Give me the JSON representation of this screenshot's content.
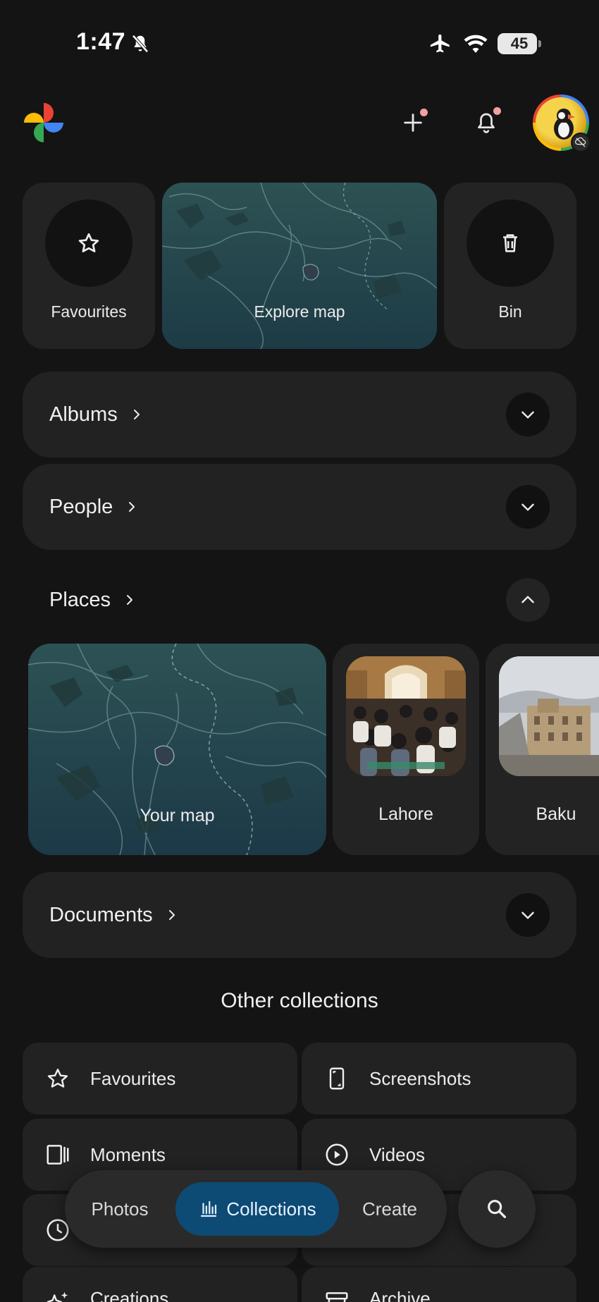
{
  "status_bar": {
    "time": "1:47",
    "battery_level": "45"
  },
  "header": {
    "logo": "google-photos-pinwheel-icon",
    "add_icon": "plus-icon",
    "notifications_icon": "bell-icon",
    "accent_dot_color": "#f2a0a0"
  },
  "quick_tiles": {
    "favourites_label": "Favourites",
    "map_label": "Explore map",
    "bin_label": "Bin"
  },
  "sections": {
    "albums": "Albums",
    "people": "People",
    "places": "Places",
    "documents": "Documents"
  },
  "places": {
    "map_label": "Your map",
    "items": [
      {
        "label": "Lahore"
      },
      {
        "label": "Baku"
      }
    ]
  },
  "other_collections": {
    "title": "Other collections",
    "items": [
      {
        "label": "Favourites",
        "icon": "star-icon"
      },
      {
        "label": "Screenshots",
        "icon": "phone-screenshot-icon"
      },
      {
        "label": "Moments",
        "icon": "moments-icon"
      },
      {
        "label": "Videos",
        "icon": "play-circle-icon"
      },
      {
        "label": "",
        "icon": "clock-icon"
      },
      {
        "label": "",
        "icon": ""
      },
      {
        "label": "Creations",
        "icon": "sparkle-icon"
      },
      {
        "label": "Archive",
        "icon": "archive-icon"
      }
    ]
  },
  "bottom_nav": {
    "photos": "Photos",
    "collections": "Collections",
    "create": "Create",
    "active": "Collections",
    "active_color": "#0d4a74"
  }
}
